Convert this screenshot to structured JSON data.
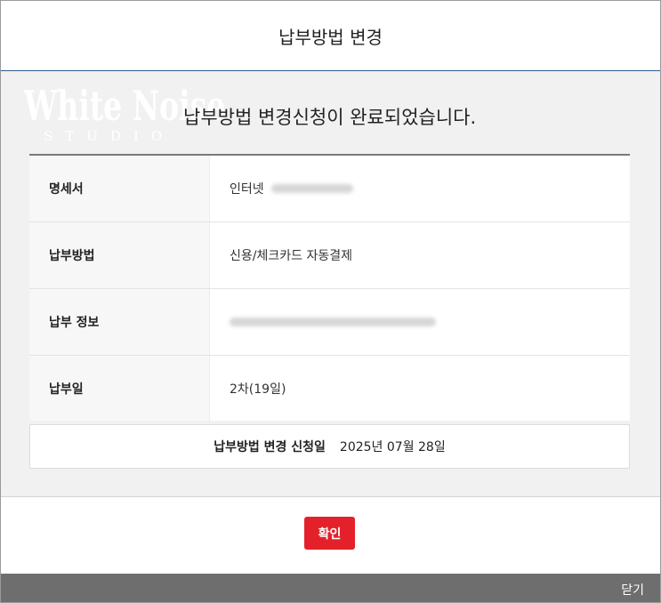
{
  "modal": {
    "title": "납부방법 변경",
    "watermark": {
      "main": "White Noise",
      "sub": "STUDIO"
    },
    "message": "납부방법 변경신청이 완료되었습니다.",
    "rows": [
      {
        "label": "명세서",
        "value": "인터넷"
      },
      {
        "label": "납부방법",
        "value": "신용/체크카드 자동결제"
      },
      {
        "label": "납부 정보",
        "value": ""
      },
      {
        "label": "납부일",
        "value": "2차(19일)"
      }
    ],
    "request_date_label": "납부방법 변경 신청일",
    "request_date_value": "2025년 07월 28일",
    "confirm_label": "확인",
    "close_label": "닫기"
  },
  "colors": {
    "accent_red": "#e4212b",
    "header_border": "#2f5e8c",
    "bottom_bar": "#6e6e6e"
  }
}
